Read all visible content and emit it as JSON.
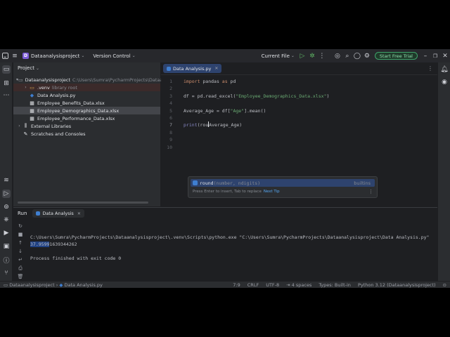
{
  "titlebar": {
    "project_badge": "D",
    "project_name": "Dataanalysisproject",
    "vcs": "Version Control",
    "run_config": "Current File",
    "trial_button": "Start Free Trial"
  },
  "project_panel": {
    "title": "Project",
    "tree": [
      {
        "label": "Dataanalysisproject",
        "extra": "C:\\Users\\Sumra\\PycharmProjects\\Dataanal",
        "icon": "folder-icon",
        "toggle": "▾"
      },
      {
        "label": ".venv",
        "extra": "library root",
        "icon": "folder-icon",
        "toggle": "›"
      },
      {
        "label": "Data Analysis.py",
        "extra": "",
        "icon": "python-file-icon",
        "toggle": ""
      },
      {
        "label": "Employee_Benefits_Data.xlsx",
        "extra": "",
        "icon": "spreadsheet-icon",
        "toggle": ""
      },
      {
        "label": "Employee_Demographics_Data.xlsx",
        "extra": "",
        "icon": "spreadsheet-icon",
        "toggle": ""
      },
      {
        "label": "Employee_Performance_Data.xlsx",
        "extra": "",
        "icon": "spreadsheet-icon",
        "toggle": ""
      },
      {
        "label": "External Libraries",
        "extra": "",
        "icon": "library-icon",
        "toggle": "›"
      },
      {
        "label": "Scratches and Consoles",
        "extra": "",
        "icon": "scratches-icon",
        "toggle": ""
      }
    ]
  },
  "editor": {
    "tab_label": "Data Analysis.py",
    "line_numbers": [
      "1",
      "2",
      "3",
      "4",
      "5",
      "6",
      "7",
      "8",
      "9",
      "10"
    ],
    "code": {
      "l1_kw1": "import",
      "l1_mid": " pandas ",
      "l1_kw2": "as",
      "l1_end": " pd",
      "l3_a": "df = pd.read_excel(",
      "l3_str": "\"Employee_Demographics_Data.xlsx\"",
      "l3_b": ")",
      "l5_a": "Average_Age = df[",
      "l5_str": "\"Age\"",
      "l5_b": "].mean()",
      "l7_call": "print",
      "l7_a": "(rou",
      "l7_b": "Average_Age)"
    },
    "completion": {
      "item": "round",
      "signature": "(number, ndigits)",
      "source": "builtins",
      "hint": "Press Enter to insert, Tab to replace",
      "next_tip": "Next Tip"
    }
  },
  "run_panel": {
    "title": "Run",
    "tab_label": "Data Analysis",
    "output": {
      "command": "C:\\Users\\Sumra\\PycharmProjects\\Dataanalysisproject\\.venv\\Scripts\\python.exe \"C:\\Users\\Sumra\\PycharmProjects\\Dataanalysisproject\\Data Analysis.py\"",
      "result_selected": "37.9599",
      "result_rest": "1639344262",
      "exit": "Process finished with exit code 0"
    }
  },
  "statusbar": {
    "breadcrumb_project": "Dataanalysisproject",
    "breadcrumb_sep": "›",
    "breadcrumb_file": "Data Analysis.py",
    "position": "7:9",
    "line_ending": "CRLF",
    "encoding": "UTF-8",
    "indent": "4 spaces",
    "types": "Types: Built-in",
    "interpreter": "Python 3.12 (Dataanalysisproject)"
  },
  "colors": {
    "accent_blue": "#2e436e",
    "trial_green": "#3fa36a",
    "keyword": "#cf8e6d",
    "string": "#6aab73"
  }
}
